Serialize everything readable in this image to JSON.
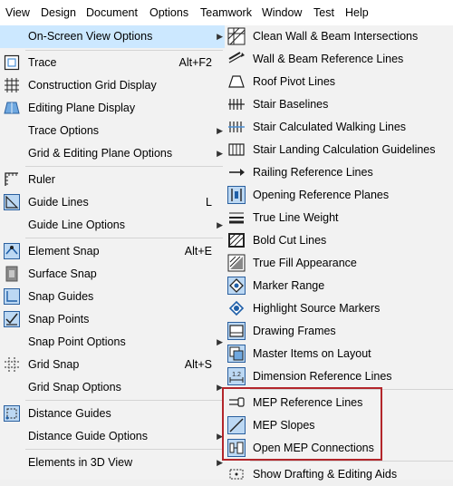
{
  "menubar": {
    "items": [
      "View",
      "Design",
      "Document",
      "Options",
      "Teamwork",
      "Window",
      "Test",
      "Help"
    ]
  },
  "left_menu": {
    "items": [
      {
        "label": "On-Screen View Options",
        "shortcut": "",
        "submenu": true,
        "selected": true,
        "icon": "none"
      },
      {
        "label": "Trace",
        "shortcut": "Alt+F2",
        "submenu": false,
        "icon": "trace-icon"
      },
      {
        "label": "Construction Grid Display",
        "shortcut": "",
        "submenu": false,
        "icon": "grid-icon"
      },
      {
        "label": "Editing Plane Display",
        "shortcut": "",
        "submenu": false,
        "icon": "editing-plane-icon"
      },
      {
        "label": "Trace Options",
        "shortcut": "",
        "submenu": true,
        "icon": "none"
      },
      {
        "label": "Grid & Editing Plane Options",
        "shortcut": "",
        "submenu": true,
        "icon": "none"
      },
      {
        "label": "Ruler",
        "shortcut": "",
        "submenu": false,
        "icon": "ruler-icon"
      },
      {
        "label": "Guide Lines",
        "shortcut": "L",
        "submenu": false,
        "icon": "guide-lines-icon"
      },
      {
        "label": "Guide Line Options",
        "shortcut": "",
        "submenu": true,
        "icon": "none"
      },
      {
        "label": "Element Snap",
        "shortcut": "Alt+E",
        "submenu": false,
        "icon": "element-snap-icon"
      },
      {
        "label": "Surface Snap",
        "shortcut": "",
        "submenu": false,
        "icon": "surface-snap-icon"
      },
      {
        "label": "Snap Guides",
        "shortcut": "",
        "submenu": false,
        "icon": "snap-guides-icon"
      },
      {
        "label": "Snap Points",
        "shortcut": "",
        "submenu": false,
        "icon": "snap-points-icon"
      },
      {
        "label": "Snap Point Options",
        "shortcut": "",
        "submenu": true,
        "icon": "none"
      },
      {
        "label": "Grid Snap",
        "shortcut": "Alt+S",
        "submenu": false,
        "icon": "grid-snap-icon"
      },
      {
        "label": "Grid Snap Options",
        "shortcut": "",
        "submenu": true,
        "icon": "none"
      },
      {
        "label": "Distance Guides",
        "shortcut": "",
        "submenu": false,
        "icon": "distance-guides-icon"
      },
      {
        "label": "Distance Guide Options",
        "shortcut": "",
        "submenu": true,
        "icon": "none"
      },
      {
        "label": "Elements in 3D View",
        "shortcut": "",
        "submenu": true,
        "icon": "none"
      }
    ]
  },
  "submenu": {
    "items": [
      {
        "label": "Clean Wall & Beam Intersections",
        "icon": "clean-intersections-icon"
      },
      {
        "label": "Wall & Beam Reference Lines",
        "icon": "reference-lines-icon"
      },
      {
        "label": "Roof Pivot Lines",
        "icon": "roof-pivot-icon"
      },
      {
        "label": "Stair Baselines",
        "icon": "stair-baselines-icon"
      },
      {
        "label": "Stair Calculated Walking Lines",
        "icon": "stair-walking-lines-icon"
      },
      {
        "label": "Stair Landing Calculation Guidelines",
        "icon": "stair-landing-icon"
      },
      {
        "label": "Railing Reference Lines",
        "icon": "railing-reference-icon"
      },
      {
        "label": "Opening Reference Planes",
        "icon": "opening-reference-icon"
      },
      {
        "label": "True Line Weight",
        "icon": "line-weight-icon"
      },
      {
        "label": "Bold Cut Lines",
        "icon": "bold-cut-icon"
      },
      {
        "label": "True Fill Appearance",
        "icon": "fill-appearance-icon"
      },
      {
        "label": "Marker Range",
        "icon": "marker-range-icon"
      },
      {
        "label": "Highlight Source Markers",
        "icon": "source-markers-icon"
      },
      {
        "label": "Drawing Frames",
        "icon": "drawing-frames-icon"
      },
      {
        "label": "Master Items on Layout",
        "icon": "master-items-icon"
      },
      {
        "label": "Dimension Reference Lines",
        "icon": "dimension-reference-icon"
      },
      {
        "label": "MEP Reference Lines",
        "icon": "mep-reference-icon"
      },
      {
        "label": "MEP Slopes",
        "icon": "mep-slopes-icon"
      },
      {
        "label": "Open MEP Connections",
        "icon": "mep-connections-icon"
      },
      {
        "label": "Show Drafting & Editing Aids",
        "icon": "drafting-aids-icon"
      }
    ],
    "dimension_icon_text": "1.2"
  },
  "colors": {
    "selected_bg": "#cce8ff",
    "highlight_box": "#b3262b",
    "icon_blue": "#4a8fd6"
  }
}
